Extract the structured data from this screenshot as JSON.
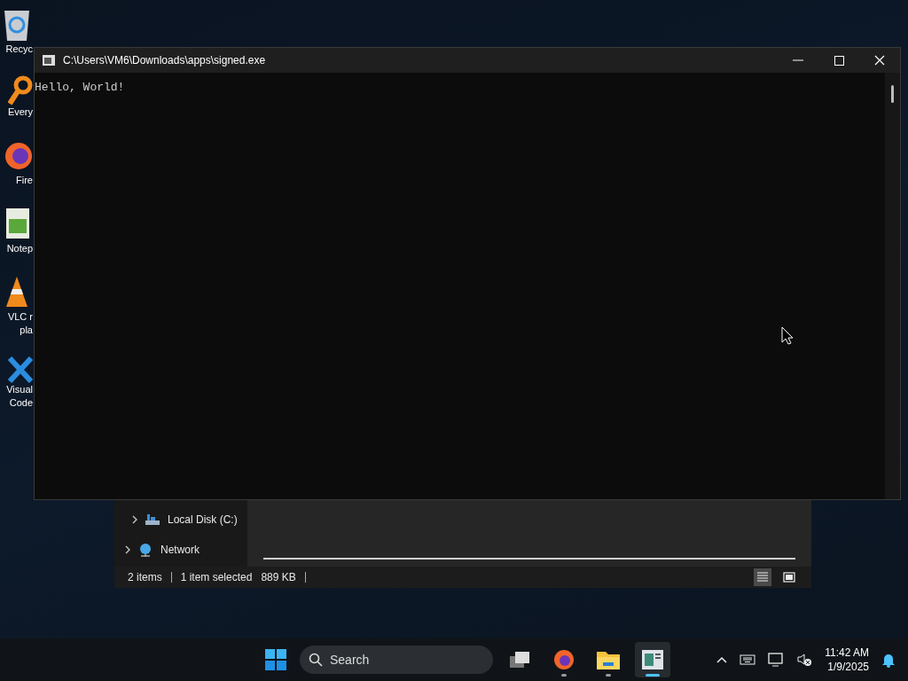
{
  "desktop_icons": [
    {
      "kind": "recycle",
      "lines": [
        "Recyc"
      ]
    },
    {
      "kind": "search",
      "lines": [
        "Every"
      ]
    },
    {
      "kind": "browser",
      "lines": [
        "Fire"
      ]
    },
    {
      "kind": "notepad",
      "lines": [
        "Notep"
      ]
    },
    {
      "kind": "cone",
      "lines": [
        "VLC r",
        "pla"
      ]
    },
    {
      "kind": "code",
      "lines": [
        "Visual",
        "Code"
      ]
    }
  ],
  "explorer": {
    "nav_items": [
      {
        "kind": "disk",
        "label": "Local Disk (C:)"
      },
      {
        "kind": "network",
        "label": "Network"
      }
    ],
    "status_bar": [
      "2 items",
      "1 item selected",
      "889 KB"
    ],
    "view_buttons": [
      {
        "kind": "details",
        "selected": true
      },
      {
        "kind": "tiles",
        "selected": false
      }
    ]
  },
  "console": {
    "title": "C:\\Users\\VM6\\Downloads\\apps\\signed.exe",
    "output": "Hello, World!"
  },
  "taskbar": {
    "search": {
      "placeholder": "Search"
    },
    "apps": [
      {
        "kind": "taskview",
        "running": false,
        "active": false
      },
      {
        "kind": "browser",
        "running": true,
        "active": false
      },
      {
        "kind": "folder",
        "running": true,
        "active": false
      },
      {
        "kind": "console",
        "running": true,
        "active": true
      }
    ],
    "time": "11:42 AM",
    "date": "1/9/2025"
  }
}
